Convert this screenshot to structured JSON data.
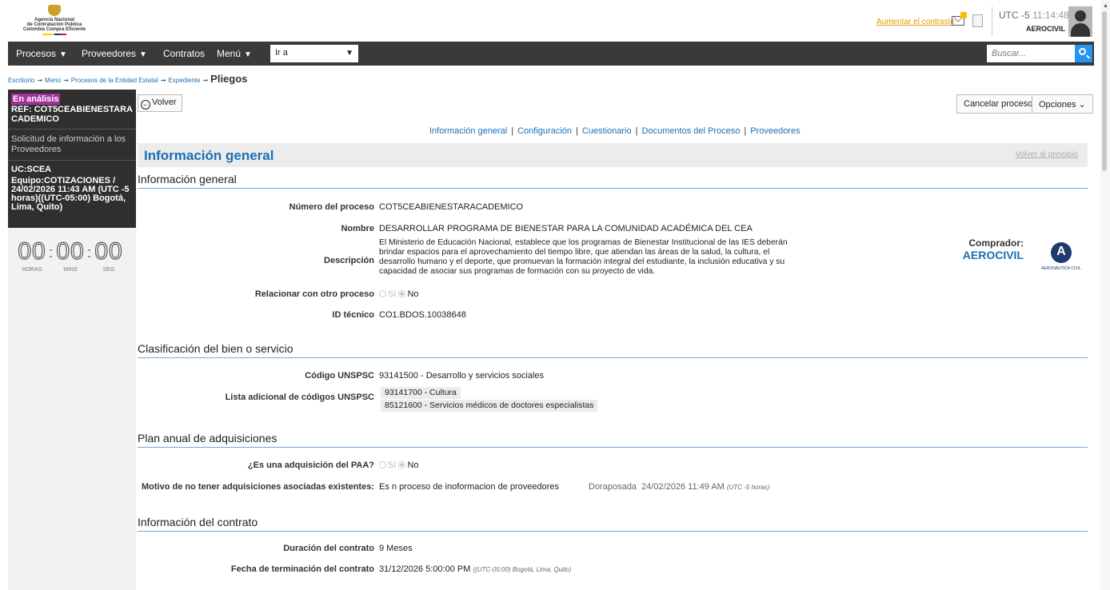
{
  "header": {
    "logo_lines": [
      "Agencia Nacional",
      "de Contratación Pública",
      "Colombia Compra Eficiente"
    ],
    "contrast_link": "Aumentar el contraste",
    "utc_label": "UTC -5",
    "time": "11:14:48",
    "user": "AEROCIVIL"
  },
  "nav": {
    "items": [
      "Procesos",
      "Proveedores",
      "Contratos",
      "Menú"
    ],
    "goto_label": "Ir a",
    "search_placeholder": "Buscar..."
  },
  "breadcrumb": {
    "items": [
      "Escritorio",
      "Menú",
      "Procesos de la Entidad Estatal",
      "Expediente"
    ],
    "current": "Pliegos"
  },
  "sidebar": {
    "status": "En análisis",
    "ref": "REF: COT5CEABIENESTARACADEMICO",
    "phase": "Solicitud de información a los Proveedores",
    "uc": "UC:SCEA",
    "team": "Equipo:COTIZACIONES / 24/02/2026 11:43 AM (UTC -5 horas)((UTC-05:00) Bogotá, Lima, Quito)",
    "timer": [
      {
        "value": "00",
        "label": "HORAS"
      },
      {
        "value": "00",
        "label": "MINS"
      },
      {
        "value": "00",
        "label": "SEG"
      }
    ]
  },
  "toolbar": {
    "back": "Volver",
    "cancel": "Cancelar proceso",
    "options": "Opciones"
  },
  "tabs": [
    "Información general",
    "Configuración",
    "Cuestionario",
    "Documentos del Proceso",
    "Proveedores"
  ],
  "section": {
    "title": "Información general",
    "back_top": "Volver al principio"
  },
  "general": {
    "heading": "Información general",
    "numero_label": "Número del proceso",
    "numero": "COT5CEABIENESTARACADEMICO",
    "nombre_label": "Nombre",
    "nombre": "DESARROLLAR PROGRAMA DE BIENESTAR PARA LA COMUNIDAD ACADÉMICA DEL CEA",
    "descripcion_label": "Descripción",
    "descripcion": "El Ministerio de Educación Nacional, establece que los programas de Bienestar Institucional de las IES deberán brindar espacios para el aprovechamiento del tiempo libre, que atiendan las áreas de la salud, la cultura, el desarrollo humano y el deporte, que promuevan la formación integral del estudiante, la inclusión educativa y su capacidad de asociar sus programas de formación con su proyecto de vida.",
    "relacionar_label": "Relacionar con otro proceso",
    "si": "Sí",
    "no": "No",
    "id_label": "ID técnico",
    "id": "CO1.BDOS.10038648",
    "buyer_label": "Comprador:",
    "buyer": "AEROCIVIL",
    "buyer_logo_text": "AERONÁUTICA CIVIL"
  },
  "clasificacion": {
    "heading": "Clasificación del bien o servicio",
    "codigo_label": "Código UNSPSC",
    "codigo": "93141500 - Desarrollo y servicios sociales",
    "lista_label": "Lista adicional de códigos UNSPSC",
    "lista": [
      "93141700 - Cultura",
      "85121600 - Servicios médicos de doctores especialistas"
    ]
  },
  "paa": {
    "heading": "Plan anual de adquisiciones",
    "q_label": "¿Es una adquisición del PAA?",
    "si": "Sí",
    "no": "No",
    "motivo_label": "Motivo de no tener adquisiciones asociadas existentes:",
    "motivo": "Es n proceso de inoformacion de proveedores",
    "author": "Doraposada",
    "date": "24/02/2026 11:49 AM",
    "tz": "(UTC -5 horas)"
  },
  "contrato": {
    "heading": "Información del contrato",
    "duracion_label": "Duración del contrato",
    "duracion": "9 Meses",
    "fecha_label": "Fecha de terminación del contrato",
    "fecha": "31/12/2026 5:00:00 PM",
    "tz": "((UTC-05:00) Bogotá, Lima, Quito)"
  },
  "colors": {
    "accent": "#1a6fb5",
    "nav_bg": "#3a3a3a",
    "status_badge": "#a3309f",
    "search_btn": "#2196f3"
  }
}
